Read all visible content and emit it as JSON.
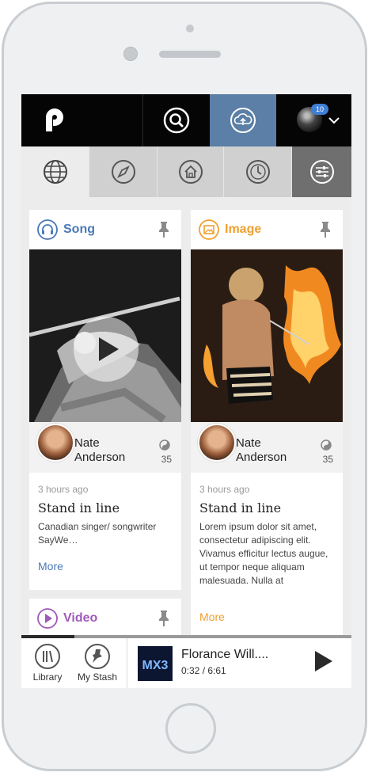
{
  "topbar": {
    "logo_icon": "app-logo-icon",
    "search_icon": "search-icon",
    "upload_icon": "cloud-upload-icon",
    "notification_count": "10",
    "accent_color": "#5b7fa6"
  },
  "nav": {
    "items": [
      {
        "icon": "globe-icon",
        "active": true
      },
      {
        "icon": "compass-icon",
        "active": false
      },
      {
        "icon": "home-icon",
        "active": false
      },
      {
        "icon": "clock-icon",
        "active": false
      },
      {
        "icon": "filter-settings-icon",
        "active": false
      }
    ]
  },
  "cards": [
    {
      "type": "Song",
      "type_color": "#4a78b8",
      "author": "Nate Anderson",
      "stat": "35",
      "time": "3 hours ago",
      "title": "Stand in line",
      "description": "Canadian singer/ songwriter SayWe…",
      "more": "More"
    },
    {
      "type": "Image",
      "type_color": "#f0a030",
      "author": "Nate Anderson",
      "stat": "35",
      "time": "3 hours ago",
      "title": "Stand in line",
      "description": "Lorem ipsum dolor sit amet, consectetur adipiscing elit. Vivamus efficitur lectus augue, ut tempor neque aliquam malesuada. Nulla at",
      "more": "More"
    },
    {
      "type": "Video",
      "type_color": "#a05ab8"
    }
  ],
  "bottom": {
    "library_label": "Library",
    "stash_label": "My Stash",
    "album_text": "MX3",
    "track_title": "Florance Will....",
    "track_time": "0:32 / 6:61",
    "progress": 0.16
  }
}
